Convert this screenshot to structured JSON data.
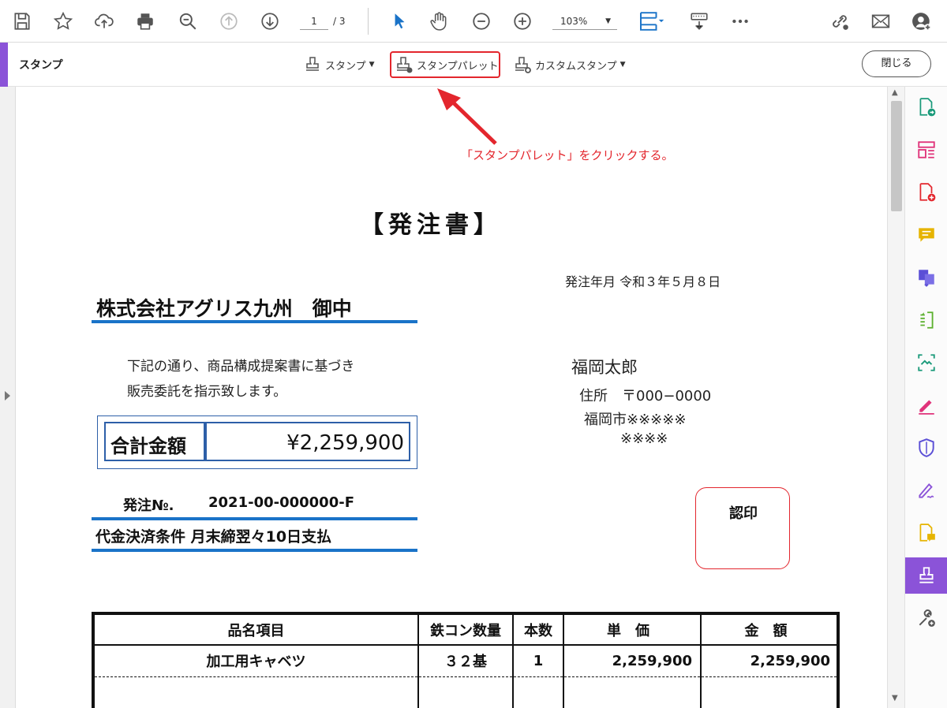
{
  "toolbar": {
    "page_current": "1",
    "page_total": "/ 3",
    "zoom": "103%",
    "icons": [
      "save-icon",
      "bookmark-star-icon",
      "cloud-upload-icon",
      "print-icon",
      "zoom-search-icon",
      "page-up-icon",
      "page-down-icon",
      "select-cursor-icon",
      "hand-tool-icon",
      "zoom-out-icon",
      "zoom-in-icon",
      "fit-page-icon",
      "read-mode-icon",
      "more-icon",
      "share-link-icon",
      "email-icon",
      "account-icon"
    ]
  },
  "stamp_bar": {
    "title": "スタンプ",
    "stamp_button": "スタンプ",
    "palette_button": "スタンプパレット",
    "custom_button": "カスタムスタンプ",
    "close_button": "閉じる"
  },
  "annotation": {
    "text": "「スタンプパレット」をクリックする。",
    "color": "#e3262d"
  },
  "document": {
    "title": "【発注書】",
    "order_date": "発注年月 令和３年５月８日",
    "recipient": "株式会社アグリス九州　御中",
    "description_line1": "下記の通り、商品構成提案書に基づき",
    "description_line2": "販売委託を指示致します。",
    "sender_name": "福岡太郎",
    "sender_address_line1": "住所　〒000−0000",
    "sender_address_line2": "福岡市※※※※※",
    "sender_address_line3": "※※※※",
    "total_label": "合計金額",
    "total_value": "¥2,259,900",
    "order_no_label": "発注№.",
    "order_no_value": "2021-00-000000-F",
    "payment_terms": "代金決済条件 月末締翌々10日支払",
    "seal_label": "認印",
    "table": {
      "headers": [
        "品名項目",
        "鉄コン数量",
        "本数",
        "単　価",
        "金　額"
      ],
      "rows": [
        [
          "加工用キャベツ",
          "３２基",
          "1",
          "2,259,900",
          "2,259,900"
        ]
      ]
    }
  },
  "colors": {
    "accent": "#8b53d8",
    "highlight": "#e3262d",
    "rule_blue": "#1a73c8"
  }
}
